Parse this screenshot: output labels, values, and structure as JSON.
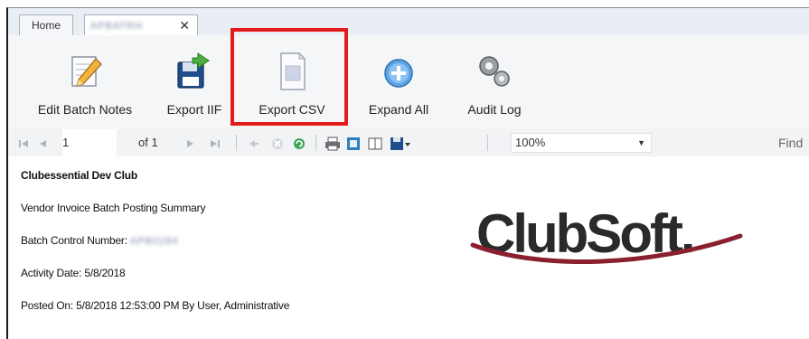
{
  "tabs": {
    "home_label": "Home",
    "active_label_blurred": "APBATRH",
    "close_glyph": "✕"
  },
  "ribbon": {
    "edit_batch_notes": "Edit Batch Notes",
    "export_iif": "Export IIF",
    "export_csv": "Export CSV",
    "expand_all": "Expand All",
    "audit_log": "Audit Log",
    "highlight_color": "#e41b1b"
  },
  "viewer_toolbar": {
    "current_page": "1",
    "page_total": "of 1",
    "zoom_value": "100%",
    "find_label": "Find"
  },
  "report": {
    "club_name": "Clubessential Dev Club",
    "report_title": "Vendor Invoice Batch Posting Summary",
    "batch_control_label": "Batch Control Number:",
    "batch_control_value_blurred": "APB0284",
    "activity_date": "Activity Date: 5/8/2018",
    "posted_on": "Posted On: 5/8/2018 12:53:00 PM By User, Administrative"
  },
  "logo": {
    "text": "ClubSoft.",
    "swoosh_color": "#8a1f2e",
    "text_color": "#2a2a2a"
  }
}
